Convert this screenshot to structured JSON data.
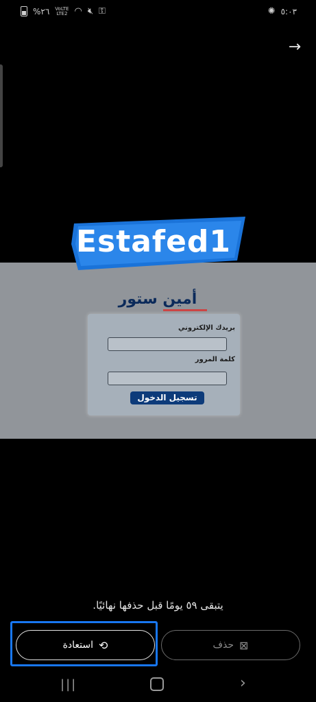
{
  "status_bar": {
    "battery_percent": "%٢٦",
    "network_top": "VoLTE",
    "network_bottom": "LTE2",
    "time": "٥:٠٣"
  },
  "preview": {
    "banner_text": "Estafed1",
    "store_title": "أمين ستور",
    "email_label": "بريدك الإلكتروني",
    "password_label": "كلمة المرور",
    "login_button": "تسجيل الدخول"
  },
  "notice": "يتبقى ٥٩ يومًا قبل حذفها نهائيًا.",
  "actions": {
    "restore_label": "استعادة",
    "delete_label": "حذف"
  },
  "icons": {
    "back": "arrow-right-icon",
    "restore": "history-icon",
    "delete": "trash-icon"
  },
  "colors": {
    "accent": "#1877f2",
    "banner_blue": "#1a73d9",
    "navy": "#0d3b7a"
  }
}
